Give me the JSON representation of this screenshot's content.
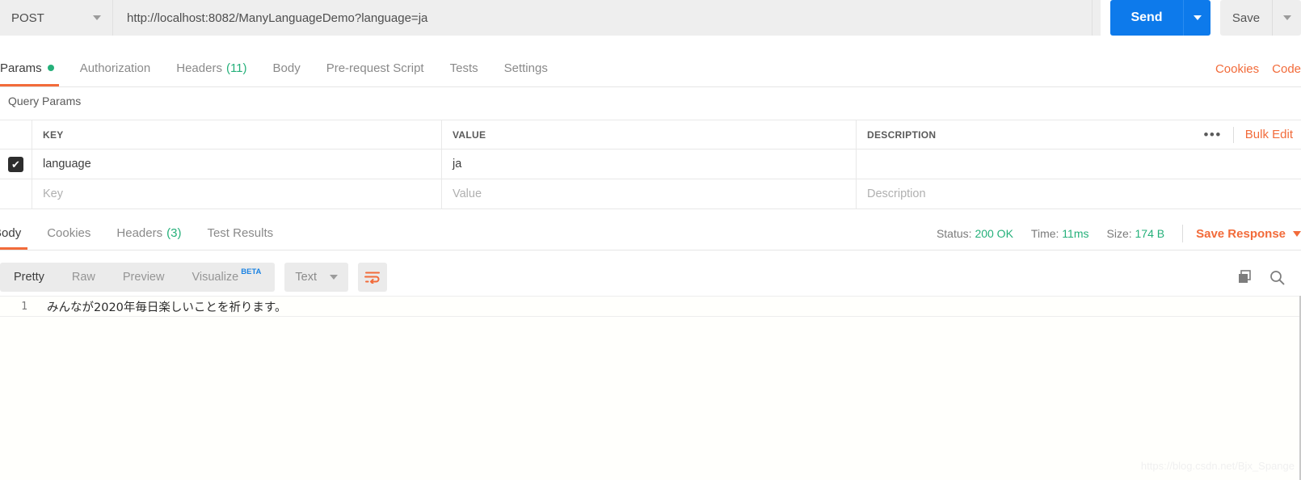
{
  "request": {
    "method": "POST",
    "url": "http://localhost:8082/ManyLanguageDemo?language=ja",
    "send_label": "Send",
    "save_label": "Save"
  },
  "request_tabs": [
    {
      "label": "Params",
      "badge": "",
      "dot": true,
      "active": true
    },
    {
      "label": "Authorization",
      "badge": "",
      "dot": false,
      "active": false
    },
    {
      "label": "Headers",
      "badge": "(11)",
      "dot": false,
      "active": false
    },
    {
      "label": "Body",
      "badge": "",
      "dot": false,
      "active": false
    },
    {
      "label": "Pre-request Script",
      "badge": "",
      "dot": false,
      "active": false
    },
    {
      "label": "Tests",
      "badge": "",
      "dot": false,
      "active": false
    },
    {
      "label": "Settings",
      "badge": "",
      "dot": false,
      "active": false
    }
  ],
  "tabs_right": {
    "cookies": "Cookies",
    "code": "Code"
  },
  "query_params": {
    "title": "Query Params",
    "headers": {
      "key": "KEY",
      "value": "VALUE",
      "description": "DESCRIPTION"
    },
    "bulk_edit": "Bulk Edit",
    "more_dots": "•••",
    "rows": [
      {
        "checked": true,
        "key": "language",
        "value": "ja",
        "description": ""
      }
    ],
    "placeholder_row": {
      "key": "Key",
      "value": "Value",
      "description": "Description"
    }
  },
  "response_tabs": [
    {
      "label": "Body",
      "badge": "",
      "active": true
    },
    {
      "label": "Cookies",
      "badge": "",
      "active": false
    },
    {
      "label": "Headers",
      "badge": "(3)",
      "active": false
    },
    {
      "label": "Test Results",
      "badge": "",
      "active": false
    }
  ],
  "response_meta": {
    "status_label": "Status:",
    "status_value": "200 OK",
    "time_label": "Time:",
    "time_value": "11ms",
    "size_label": "Size:",
    "size_value": "174 B",
    "save_response": "Save Response"
  },
  "body_toolbar": {
    "views": [
      {
        "label": "Pretty",
        "active": true,
        "beta": ""
      },
      {
        "label": "Raw",
        "active": false,
        "beta": ""
      },
      {
        "label": "Preview",
        "active": false,
        "beta": ""
      },
      {
        "label": "Visualize",
        "active": false,
        "beta": "BETA"
      }
    ],
    "format": "Text"
  },
  "response_body": {
    "lines": [
      {
        "no": "1",
        "text": "みんなが2020年毎日楽しいことを祈ります。"
      }
    ]
  },
  "watermark": "https://blog.csdn.net/Bjx_Spange",
  "colors": {
    "accent_orange": "#f26b3a",
    "send_blue": "#0d7aeb",
    "status_green": "#25b07a",
    "beta_blue": "#1a82e2"
  }
}
